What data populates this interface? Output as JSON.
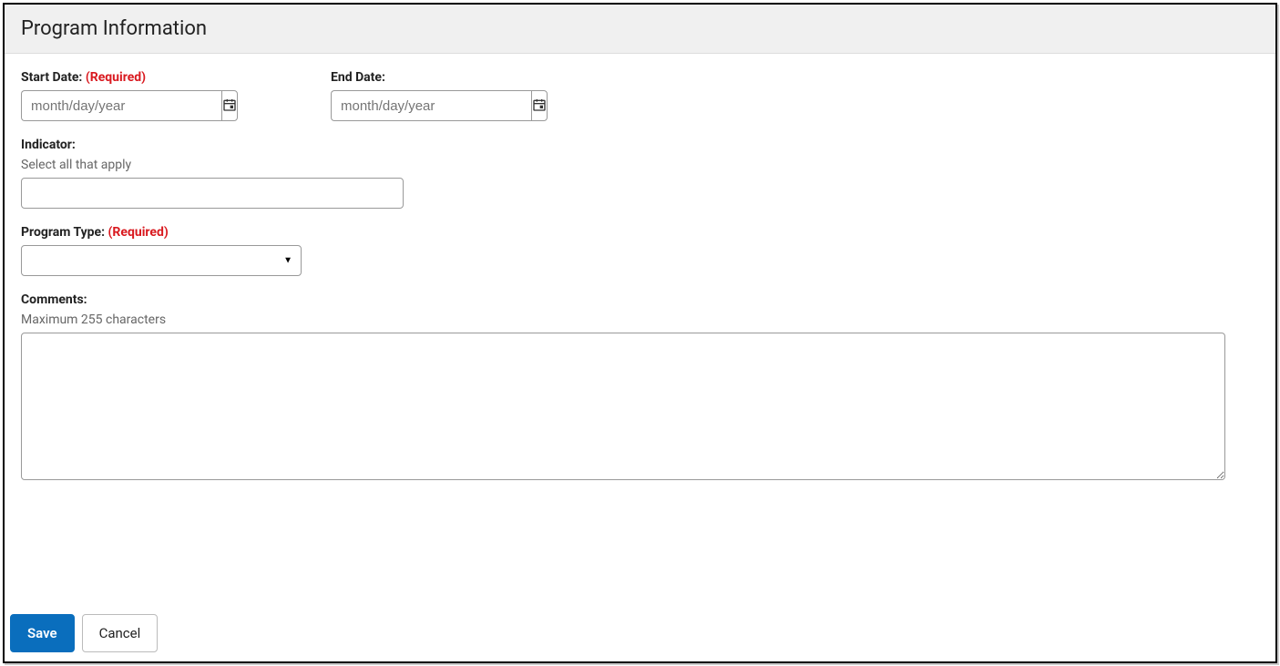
{
  "header": {
    "title": "Program Information"
  },
  "fields": {
    "startDate": {
      "label": "Start Date:",
      "required": "(Required)",
      "placeholder": "month/day/year"
    },
    "endDate": {
      "label": "End Date:",
      "placeholder": "month/day/year"
    },
    "indicator": {
      "label": "Indicator:",
      "helper": "Select all that apply"
    },
    "programType": {
      "label": "Program Type:",
      "required": "(Required)"
    },
    "comments": {
      "label": "Comments:",
      "helper": "Maximum 255 characters"
    }
  },
  "buttons": {
    "save": "Save",
    "cancel": "Cancel"
  }
}
